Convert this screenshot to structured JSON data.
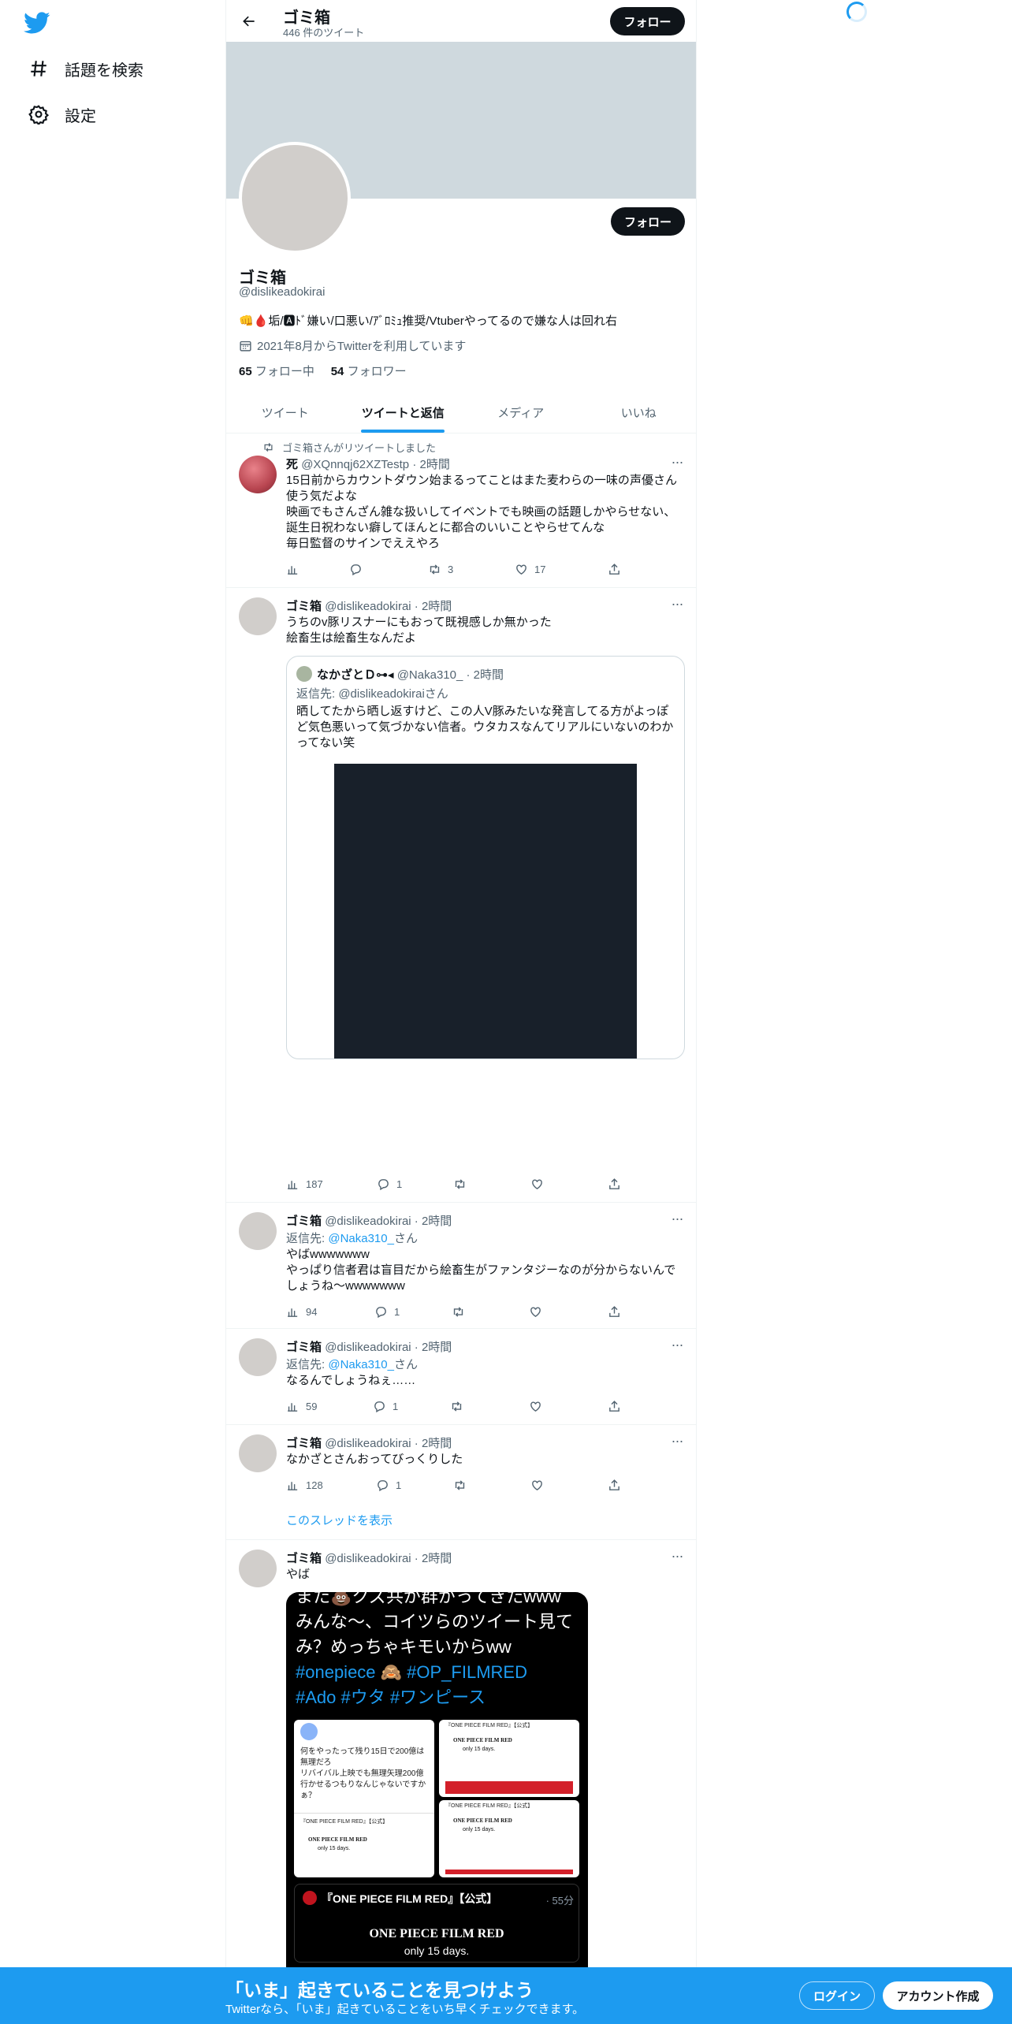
{
  "nav": {
    "explore_label": "話題を検索",
    "settings_label": "設定"
  },
  "header": {
    "title": "ゴミ箱",
    "tweet_count": "446 件のツイート",
    "follow_label": "フォロー"
  },
  "profile": {
    "name": "ゴミ箱",
    "handle": "@dislikeadokirai",
    "bio": "👊🩸垢/🅰ﾄﾞ嫌い/口悪い/ｱﾞﾛﾐｭ推奨/Vtuberやってるので嫌な人は回れ右",
    "joined": "2021年8月からTwitterを利用しています",
    "following_count": "65",
    "following_label": "フォロー中",
    "followers_count": "54",
    "followers_label": "フォロワー",
    "follow_label": "フォロー"
  },
  "tabs": [
    {
      "label": "ツイート"
    },
    {
      "label": "ツイートと返信"
    },
    {
      "label": "メディア"
    },
    {
      "label": "いいね"
    }
  ],
  "tweets": [
    {
      "retweet_label": "ゴミ箱さんがリツイートしました",
      "name": "死",
      "handle_time": "@XQnnqj62XZTestp · 2時間",
      "text": "15日前からカウントダウン始まるってことはまた麦わらの一味の声優さん使う気だよな\n映画でもさんざん雑な扱いしてイベントでも映画の話題しかやらせない、誕生日祝わない癖してほんとに都合のいいことやらせてんな\n毎日監督のサインでええやろ",
      "views": "",
      "replies": "",
      "retweets": "3",
      "likes": "17"
    },
    {
      "name": "ゴミ箱",
      "handle_time": "@dislikeadokirai · 2時間",
      "text": "うちのv豚リスナーにもおって既視感しか無かった\n絵畜生は絵畜生なんだよ",
      "quote": {
        "name": "なかざとＤ⊶◂",
        "handle_time": "@Naka310_ · 2時間",
        "reply_to": "返信先: @dislikeadokiraiさん",
        "text": "晒してたから晒し返すけど、この人V豚みたいな発言してる方がよっぽど気色悪いって気づかない信者。ウタカスなんてリアルにいないのわかってない笑"
      },
      "views": "187",
      "replies": "1",
      "retweets": "",
      "likes": ""
    },
    {
      "name": "ゴミ箱",
      "handle_time": "@dislikeadokirai · 2時間",
      "reply_prefix": "返信先: ",
      "reply_to": "@Naka310_",
      "reply_suffix": "さん",
      "text": "やばwwwwwww\nやっぱり信者君は盲目だから絵畜生がファンタジーなのが分からないんでしょうね〜wwwwwww",
      "views": "94",
      "replies": "1",
      "retweets": "",
      "likes": ""
    },
    {
      "name": "ゴミ箱",
      "handle_time": "@dislikeadokirai · 2時間",
      "reply_prefix": "返信先: ",
      "reply_to": "@Naka310_",
      "reply_suffix": "さん",
      "text": "なるんでしょうねぇ……",
      "views": "59",
      "replies": "1",
      "retweets": "",
      "likes": ""
    },
    {
      "name": "ゴミ箱",
      "handle_time": "@dislikeadokirai · 2時間",
      "text": "なかざとさんおってびっくりした",
      "views": "128",
      "replies": "1",
      "retweets": "",
      "likes": "",
      "show_thread": "このスレッドを表示"
    },
    {
      "name": "ゴミ箱",
      "handle_time": "@dislikeadokirai · 2時間",
      "text": "やば",
      "media": {
        "line1": "また💩クズ共が群がってきたwww",
        "line2": "みんな〜、コイツらのツイート見てみ？めっちゃキモいからww",
        "tags1": "#onepiece 🙈 #OP_FILMRED",
        "tags2": "#Ado #ウタ #ワンピース",
        "cell1_text": "何をやったって残り15日で200億は無理だろ\nリバイバル上映でも無理矢理200億行かせるつもりなんじゃないですかぁ？",
        "cell_title": "『ONE PIECE FILM RED』【公式】",
        "film": "ONE PIECE FILM RED",
        "only": "only 15 days.",
        "bottom_title": "『ONE PIECE FILM RED』【公式】",
        "bottom_time": "· 55分",
        "bottom_film": "ONE PIECE FILM RED",
        "bottom_only": "only 15 days."
      }
    }
  ],
  "bottom_bar": {
    "title": "「いま」起きていることを見つけよう",
    "subtitle": "Twitterなら、「いま」起きていることをいち早くチェックできます。",
    "login": "ログイン",
    "signup": "アカウント作成"
  }
}
